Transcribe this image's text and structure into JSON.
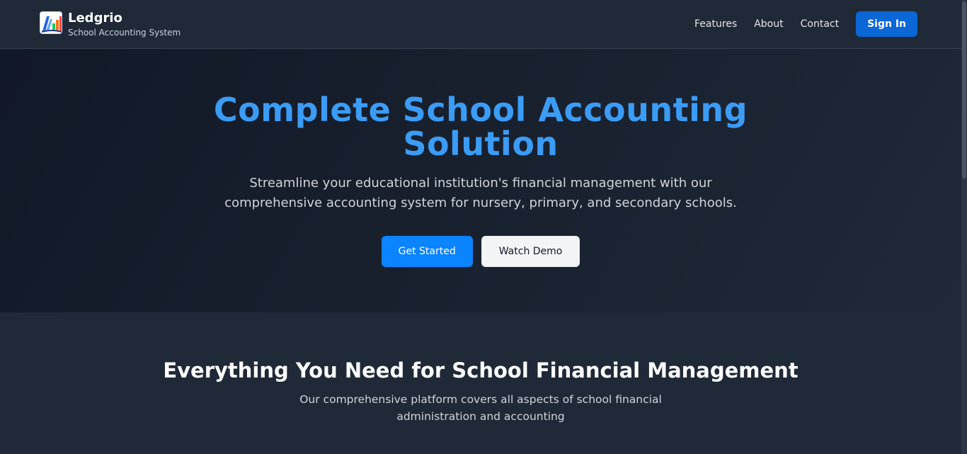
{
  "brand": {
    "name": "Ledgrio",
    "tagline": "School Accounting System",
    "logo_icon": "ledger-chart-logo-icon"
  },
  "nav": {
    "links": [
      "Features",
      "About",
      "Contact"
    ],
    "signin_label": "Sign In"
  },
  "hero": {
    "title_line1": "Complete School Accounting",
    "title_line2": "Solution",
    "subtitle_line1": "Streamline your educational institution's financial management with our",
    "subtitle_line2": "comprehensive accounting system for nursery, primary, and secondary schools.",
    "primary_cta": "Get Started",
    "secondary_cta": "Watch Demo"
  },
  "features": {
    "title": "Everything You Need for School Financial Management",
    "subtitle_line1": "Our comprehensive platform covers all aspects of school financial",
    "subtitle_line2": "administration and accounting"
  },
  "colors": {
    "accent": "#3b9cf6",
    "primary_button": "#0b84ff",
    "signin_button": "#0b66d6",
    "background": "#1f2937",
    "hero_background": "#111827"
  }
}
